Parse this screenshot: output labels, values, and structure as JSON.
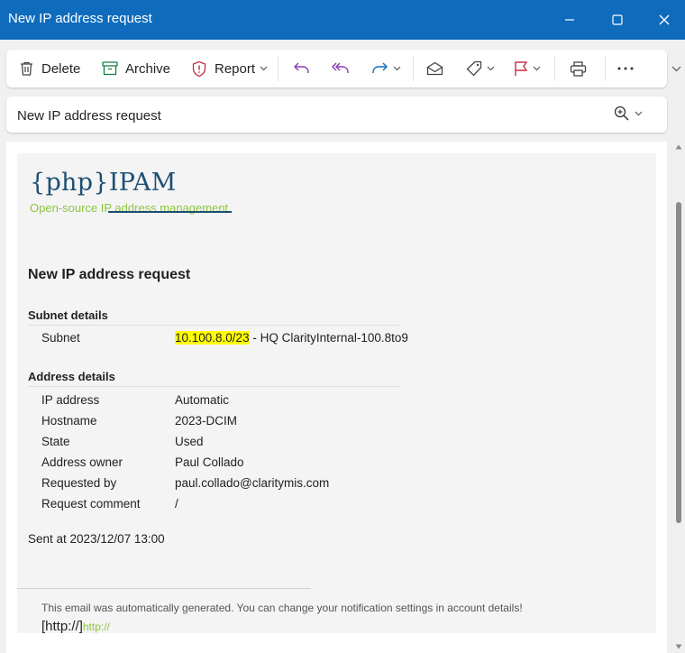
{
  "window": {
    "title": "New IP address request"
  },
  "toolbar": {
    "delete_label": "Delete",
    "archive_label": "Archive",
    "report_label": "Report"
  },
  "subject_bar": {
    "subject": "New IP address request"
  },
  "email": {
    "logo": {
      "text": "{php}IPAM",
      "tagline": "Open-source IP address management"
    },
    "heading": "New IP address request",
    "subnet_section": {
      "title": "Subnet details",
      "label": "Subnet",
      "value_highlighted": "10.100.8.0/23",
      "value_rest": " - HQ ClarityInternal-100.8to9"
    },
    "address_section": {
      "title": "Address details",
      "rows": [
        {
          "label": "IP address",
          "value": "Automatic"
        },
        {
          "label": "Hostname",
          "value": "2023-DCIM"
        },
        {
          "label": "State",
          "value": "Used"
        },
        {
          "label": "Address owner",
          "value": "Paul Collado"
        },
        {
          "label": "Requested by",
          "value": "paul.collado@claritymis.com"
        },
        {
          "label": "Request comment",
          "value": "/"
        }
      ]
    },
    "sent_at": "Sent at 2023/12/07 13:00",
    "footer": {
      "note": "This email was automatically generated. You can change your notification settings in account details!",
      "link_prefix": "[http://]",
      "link_text": "http://"
    }
  },
  "colors": {
    "titlebar": "#0f6cbd",
    "logo_blue": "#1d4f73",
    "logo_green": "#8cc63e",
    "highlight": "#ffff00",
    "report_red": "#c4314b",
    "flag_red": "#c4314b",
    "reply_purple": "#8a3bb3",
    "forward_blue": "#0f6cbd",
    "archive_green": "#107c41"
  },
  "icons": [
    "delete-icon",
    "archive-icon",
    "report-icon",
    "reply-icon",
    "reply-all-icon",
    "forward-icon",
    "mark-read-icon",
    "tag-icon",
    "flag-icon",
    "print-icon",
    "more-icon",
    "zoom-icon",
    "minimize-icon",
    "maximize-icon",
    "close-icon"
  ]
}
